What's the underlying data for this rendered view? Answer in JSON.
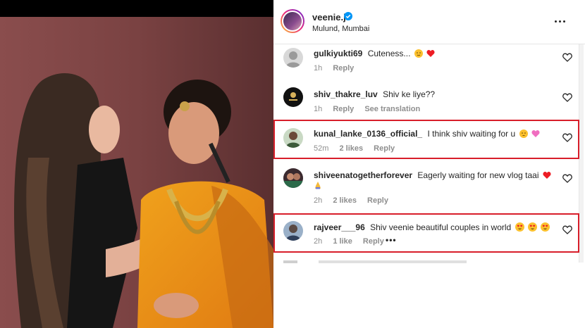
{
  "post": {
    "username": "veenie.j",
    "location": "Mulund, Mumbai"
  },
  "comments": [
    {
      "username": "gulkiyukti69",
      "text": "Cuteness...",
      "time": "1h",
      "likes": "",
      "reply": "Reply",
      "translate": ""
    },
    {
      "username": "shiv_thakre_luv",
      "text": "Shiv ke liye??",
      "time": "1h",
      "likes": "",
      "reply": "Reply",
      "translate": "See translation"
    },
    {
      "username": "kunal_lanke_0136_official_",
      "text": "I think shiv waiting for u",
      "time": "52m",
      "likes": "2 likes",
      "reply": "Reply",
      "translate": ""
    },
    {
      "username": "shiveenatogetherforever",
      "text": "Eagerly waiting for new vlog taai",
      "time": "2h",
      "likes": "2 likes",
      "reply": "Reply",
      "translate": ""
    },
    {
      "username": "rajveer___96",
      "text": "Shiv veenie beautiful couples in world",
      "time": "2h",
      "likes": "1 like",
      "reply": "Reply",
      "translate": ""
    }
  ],
  "icons": {
    "verified": "verified-badge-icon",
    "more": "more-options-icon",
    "like": "heart-outline-icon"
  },
  "colors": {
    "verified": "#0095f6",
    "highlight": "#d81e2a",
    "emoji_heart": "#ed1c24",
    "emoji_face": "#fbc02d"
  }
}
